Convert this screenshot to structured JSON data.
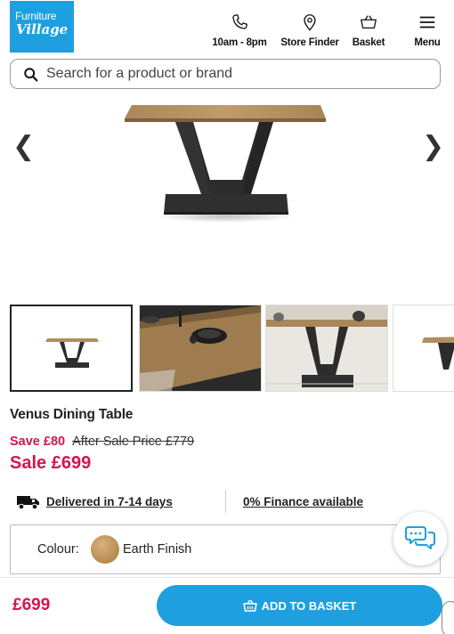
{
  "header": {
    "logo": {
      "line1": "Furniture",
      "line2": "Village"
    },
    "nav": [
      {
        "label": "10am - 8pm",
        "icon": "phone-icon"
      },
      {
        "label": "Store Finder",
        "icon": "map-pin-icon"
      },
      {
        "label": "Basket",
        "icon": "basket-icon"
      },
      {
        "label": "Menu",
        "icon": "hamburger-menu-icon"
      }
    ]
  },
  "search": {
    "placeholder": "Search for a product or brand",
    "icon": "search-icon"
  },
  "gallery": {
    "prev_arrow": "❮",
    "next_arrow": "❯",
    "thumbnails": [
      "table-front",
      "table-top-lifestyle",
      "table-room-lifestyle",
      "table-side"
    ]
  },
  "product": {
    "title": "Venus Dining Table",
    "save": "Save £80",
    "was_price": "After Sale Price £779",
    "sale_price": "Sale £699"
  },
  "info": {
    "delivery": "Delivered in 7-14 days",
    "finance": "0% Finance available"
  },
  "colour": {
    "label": "Colour:",
    "value": "Earth Finish",
    "swatch_color": "#c0925a"
  },
  "bottom_bar": {
    "price": "£699",
    "button": "ADD TO BASKET"
  },
  "colors": {
    "brand_blue": "#1ea0e0",
    "sale_red": "#d6154f"
  }
}
